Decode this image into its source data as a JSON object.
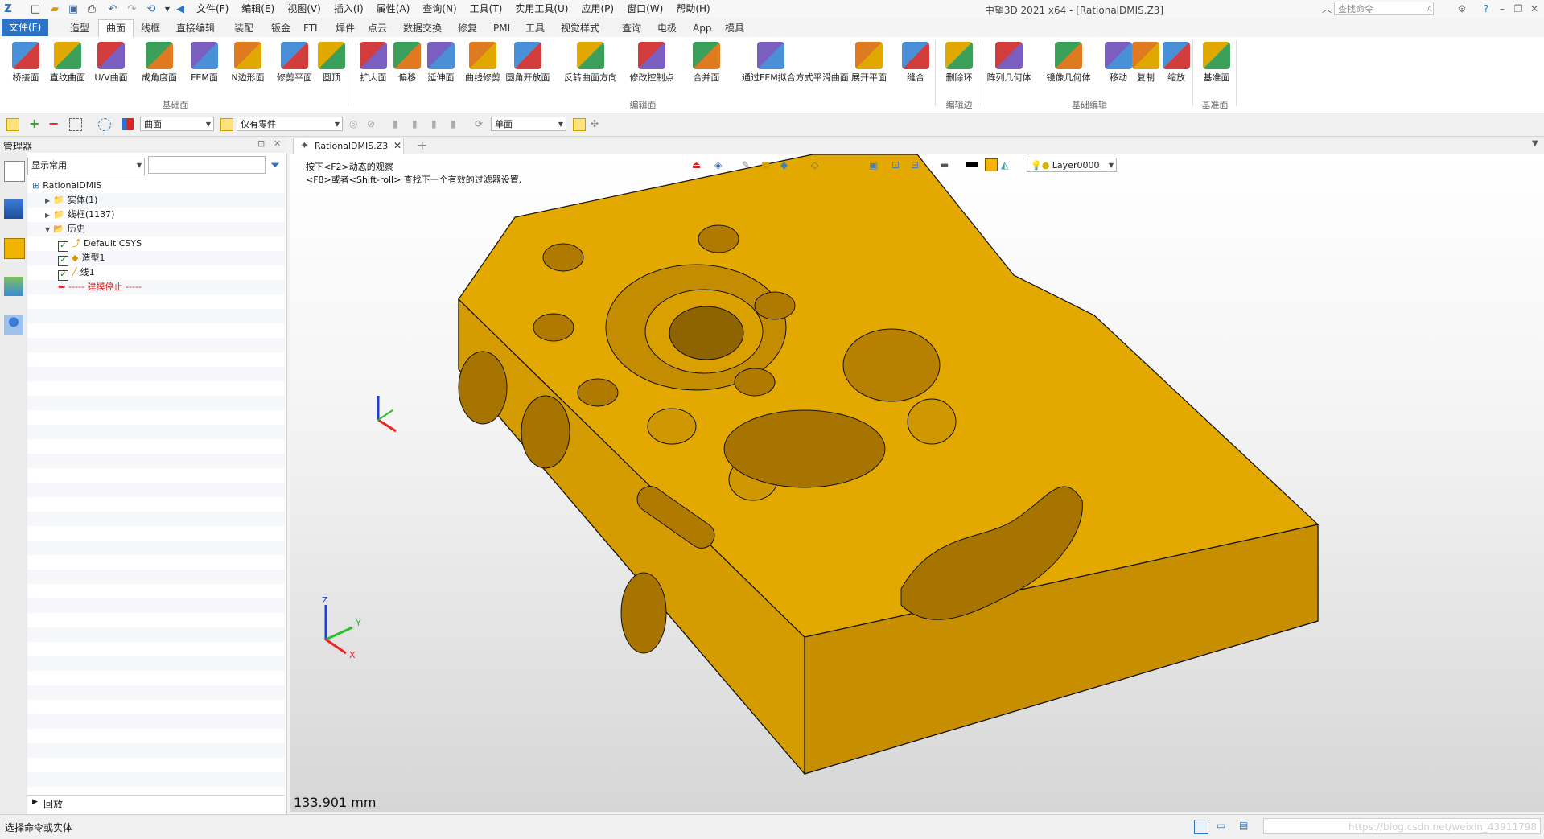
{
  "window": {
    "title": "中望3D 2021 x64 - [RationalDMIS.Z3]",
    "search_placeholder": "查找命令"
  },
  "menu": [
    "文件(F)",
    "编辑(E)",
    "视图(V)",
    "插入(I)",
    "属性(A)",
    "查询(N)",
    "工具(T)",
    "实用工具(U)",
    "应用(P)",
    "窗口(W)",
    "帮助(H)"
  ],
  "ribbon_tabs": [
    "文件(F)",
    "造型",
    "曲面",
    "线框",
    "直接编辑",
    "装配",
    "钣金",
    "FTI",
    "焊件",
    "点云",
    "数据交换",
    "修复",
    "PMI",
    "工具",
    "视觉样式",
    "查询",
    "电极",
    "App",
    "模具"
  ],
  "active_tab": "曲面",
  "ribbon_groups": [
    {
      "name": "基础面",
      "buttons": [
        "桥接面",
        "直纹曲面",
        "U/V曲面",
        "成角度面",
        "FEM面",
        "N边形面",
        "修剪平面",
        "圆顶"
      ]
    },
    {
      "name": "编辑面",
      "buttons": [
        "扩大面",
        "偏移",
        "延伸面",
        "曲线修剪",
        "圆角开放面",
        "反转曲面方向",
        "修改控制点",
        "合并面",
        "通过FEM拟合方式平滑曲面",
        "展开平面",
        "缝合"
      ]
    },
    {
      "name": "编辑边",
      "buttons": [
        "删除环"
      ]
    },
    {
      "name": "基础编辑",
      "buttons": [
        "阵列几何体",
        "镜像几何体",
        "移动",
        "复制",
        "缩放"
      ]
    },
    {
      "name": "基准面",
      "buttons": [
        "基准面"
      ]
    }
  ],
  "filter": {
    "type_value": "曲面",
    "scope_value": "仅有零件",
    "face_value": "单面"
  },
  "manager": {
    "title": "管理器",
    "display_combo": "显示常用",
    "tree": [
      {
        "label": "RationalDMIS",
        "level": 0
      },
      {
        "label": "实体(1)",
        "level": 1
      },
      {
        "label": "线框(1137)",
        "level": 1
      },
      {
        "label": "历史",
        "level": 1
      },
      {
        "label": "Default CSYS",
        "level": 2
      },
      {
        "label": "造型1",
        "level": 2
      },
      {
        "label": "线1",
        "level": 2
      },
      {
        "label": "----- 建模停止 -----",
        "level": 2
      }
    ],
    "replay_label": "回放"
  },
  "document": {
    "tab_label": "RationalDMIS.Z3",
    "hint_line1": "按下<F2>动态的观察",
    "hint_line2": "<F8>或者<Shift-roll> 查找下一个有效的过滤器设置.",
    "layer": "Layer0000",
    "measure": "133.901 mm"
  },
  "status": {
    "text": "选择命令或实体",
    "watermark": "https://blog.csdn.net/weixin_43911798"
  },
  "colors": {
    "part": "#d9a000",
    "accent": "#2b73c6"
  }
}
